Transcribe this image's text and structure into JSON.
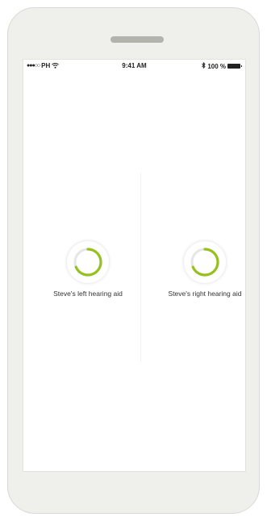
{
  "status_bar": {
    "signal_dots": "●●●○○",
    "carrier": "PH",
    "time": "9:41 AM",
    "bluetooth_icon": "bluetooth-icon",
    "battery": "100 %"
  },
  "hearing_aids": [
    {
      "label": "Steve's left hearing aid",
      "icon": "loading-spinner-icon"
    },
    {
      "label": "Steve's right hearing aid",
      "icon": "loading-spinner-icon"
    }
  ],
  "colors": {
    "accent": "#95c11f",
    "phone_body": "#efefeb",
    "speaker": "#b3b3ad"
  }
}
